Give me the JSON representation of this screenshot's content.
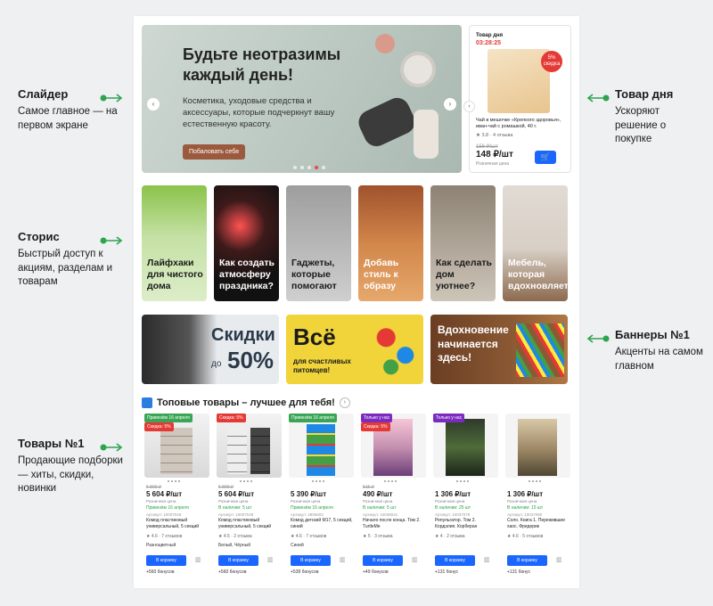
{
  "notes": [
    {
      "key": "slider",
      "title": "Слайдер",
      "text": "Самое главное — на первом экране"
    },
    {
      "key": "stories",
      "title": "Сторис",
      "text": "Быстрый доступ к акциям, разделам и товарам"
    },
    {
      "key": "products",
      "title": "Товары №1",
      "text": "Продающие подборки — хиты, скидки, новинки"
    },
    {
      "key": "deal",
      "title": "Товар дня",
      "text": "Ускоряют решение о покупке"
    },
    {
      "key": "banners",
      "title": "Баннеры №1",
      "text": "Акценты на самом главном"
    }
  ],
  "slider": {
    "title": "Будьте неотразимы каждый день!",
    "text": "Косметика, уходовые средства и аксессуары, которые подчеркнут вашу естественную красоту.",
    "button": "Побаловать себя",
    "prev": "‹",
    "next": "›"
  },
  "deal": {
    "label": "Товар дня",
    "timer": "03:28:25",
    "badge": "5% скидка",
    "name": "Чай в мешочке «Крепкого здоровья», иван-чай с ромашкой, 40 г.",
    "rating": "★ 3.8 · 4 отзыва",
    "old_price": "156 ₽/шт",
    "price": "148 ₽/шт",
    "price_sub": "Розничная цена",
    "cart_icon": "cart-icon",
    "arrow": "‹"
  },
  "stories": [
    {
      "label": "Лайфхаки для чистого дома"
    },
    {
      "label": "Как создать атмосферу праздника?"
    },
    {
      "label": "Гаджеты, которые помогают"
    },
    {
      "label": "Добавь стиль к образу"
    },
    {
      "label": "Как сделать дом уютнее?"
    },
    {
      "label": "Мебель, которая вдохновляет"
    }
  ],
  "banners": [
    {
      "title": "Скидки",
      "small": "до",
      "big": "50%"
    },
    {
      "title": "Всё",
      "sub": "для счастливых питомцев!"
    },
    {
      "title": "Вдохновение начинается здесь!"
    }
  ],
  "section": {
    "title": "Топовые товары – лучшее для тебя!",
    "arrow": "›"
  },
  "products": [
    {
      "tag": "Привезём 16 апреля",
      "tag_color": "#3aa655",
      "tag2": "Скидка: 5%",
      "old": "5 899 ₽",
      "price": "5 604 ₽/шт",
      "sub": "Розничная цена",
      "date": "Привезём 16 апреля",
      "article": "Артикул: 10007049",
      "name": "Комод пластиковый универсальный, 5 секций",
      "rating": "★ 4.6 · 7 отзывов",
      "color": "Разноцветный",
      "btn": "В корзину",
      "bonus": "+560 бонусов"
    },
    {
      "tag": "Скидка: 5%",
      "tag_color": "#e53935",
      "tag2": "",
      "old": "5 899 ₽",
      "price": "5 604 ₽/шт",
      "sub": "Розничная цена",
      "date": "В наличии: 5 шт",
      "article": "Артикул: 10007049",
      "name": "Комод пластиковый универсальный, 5 секций",
      "rating": "★ 4.5 · 2 отзыва",
      "color": "Белый, Чёрный",
      "btn": "В корзину",
      "bonus": "+560 бонусов"
    },
    {
      "tag": "Привезём 16 апреля",
      "tag_color": "#3aa655",
      "tag2": "",
      "old": "",
      "price": "5 390 ₽/шт",
      "sub": "Розничная цена",
      "date": "Привезём 16 апреля",
      "article": "Артикул: 2805803",
      "name": "Комод детский М17, 5 секций, синий",
      "rating": "★ 4.6 · 7 отзывов",
      "color": "Синий",
      "btn": "В корзину",
      "bonus": "+539 бонусов"
    },
    {
      "tag": "Только у нас",
      "tag_color": "#7b2cbf",
      "tag2": "Скидка: 5%",
      "old": "515 ₽",
      "price": "490 ₽/шт",
      "sub": "Розничная цена",
      "date": "В наличии: 5 шт",
      "article": "Артикул: 10038031",
      "name": "Начало после конца. Том 2. TurtleMe",
      "rating": "★ 5 · 3 отзыва",
      "color": "",
      "btn": "В корзину",
      "bonus": "+49 бонусов"
    },
    {
      "tag": "Только у нас",
      "tag_color": "#7b2cbf",
      "tag2": "",
      "old": "",
      "price": "1 306 ₽/шт",
      "sub": "Розничная цена",
      "date": "В наличии: 25 шт",
      "article": "Артикул: 10037079",
      "name": "Репульгатор. Том 2. Кордэлия. Корберан",
      "rating": "★ 4 · 2 отзыва",
      "color": "",
      "btn": "В корзину",
      "bonus": "+131 бонус"
    },
    {
      "tag": "",
      "tag_color": "#3aa655",
      "tag2": "",
      "old": "",
      "price": "1 306 ₽/шт",
      "sub": "Розничная цена",
      "date": "В наличии: 15 шт",
      "article": "Артикул: 10037080",
      "name": "Соло. Книга 1. Пережившие хаос. Фредерик",
      "rating": "★ 4.6 · 5 отзывов",
      "color": "",
      "btn": "В корзину",
      "bonus": "+131 бонус"
    }
  ]
}
